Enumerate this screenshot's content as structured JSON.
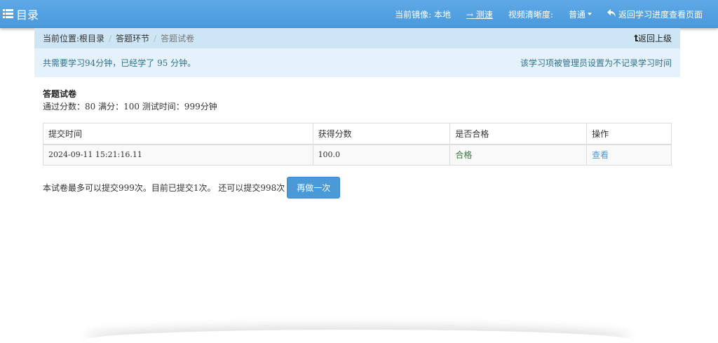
{
  "header": {
    "title": "目录",
    "mirror_label": "当前镜像:",
    "mirror_value": "本地",
    "speed_arrow": "→",
    "speed_label": "测速",
    "quality_label": "视频清晰度:",
    "quality_value": "普通",
    "back_label": "返回学习进度查看页面"
  },
  "breadcrumb": {
    "prefix": "当前位置:",
    "items": [
      "根目录",
      "答题环节",
      "答题试卷"
    ],
    "separator": "/",
    "up_label": "返回上级"
  },
  "info": {
    "progress_text": "共需要学习94分钟，已经学了 95 分钟。",
    "notice_text": "该学习项被管理员设置为不记录学习时间"
  },
  "exam": {
    "title": "答题试卷",
    "meta": "通过分数：80 满分：100 测试时间：999分钟"
  },
  "table": {
    "headers": [
      "提交时间",
      "获得分数",
      "是否合格",
      "操作"
    ],
    "rows": [
      {
        "time": "2024-09-11 15:21:16.11",
        "score": "100.0",
        "result": "合格",
        "action": "查看"
      }
    ]
  },
  "footer": {
    "submit_info": "本试卷最多可以提交999次。目前已提交1次。 还可以提交998次",
    "redo_label": "再做一次"
  },
  "colors": {
    "header_bg": "#4a99dc",
    "breadcrumb_bg": "#cde5f5",
    "info_bg": "#e5f2fb",
    "pass_green": "#3c763d",
    "link_blue": "#4a99dc"
  }
}
